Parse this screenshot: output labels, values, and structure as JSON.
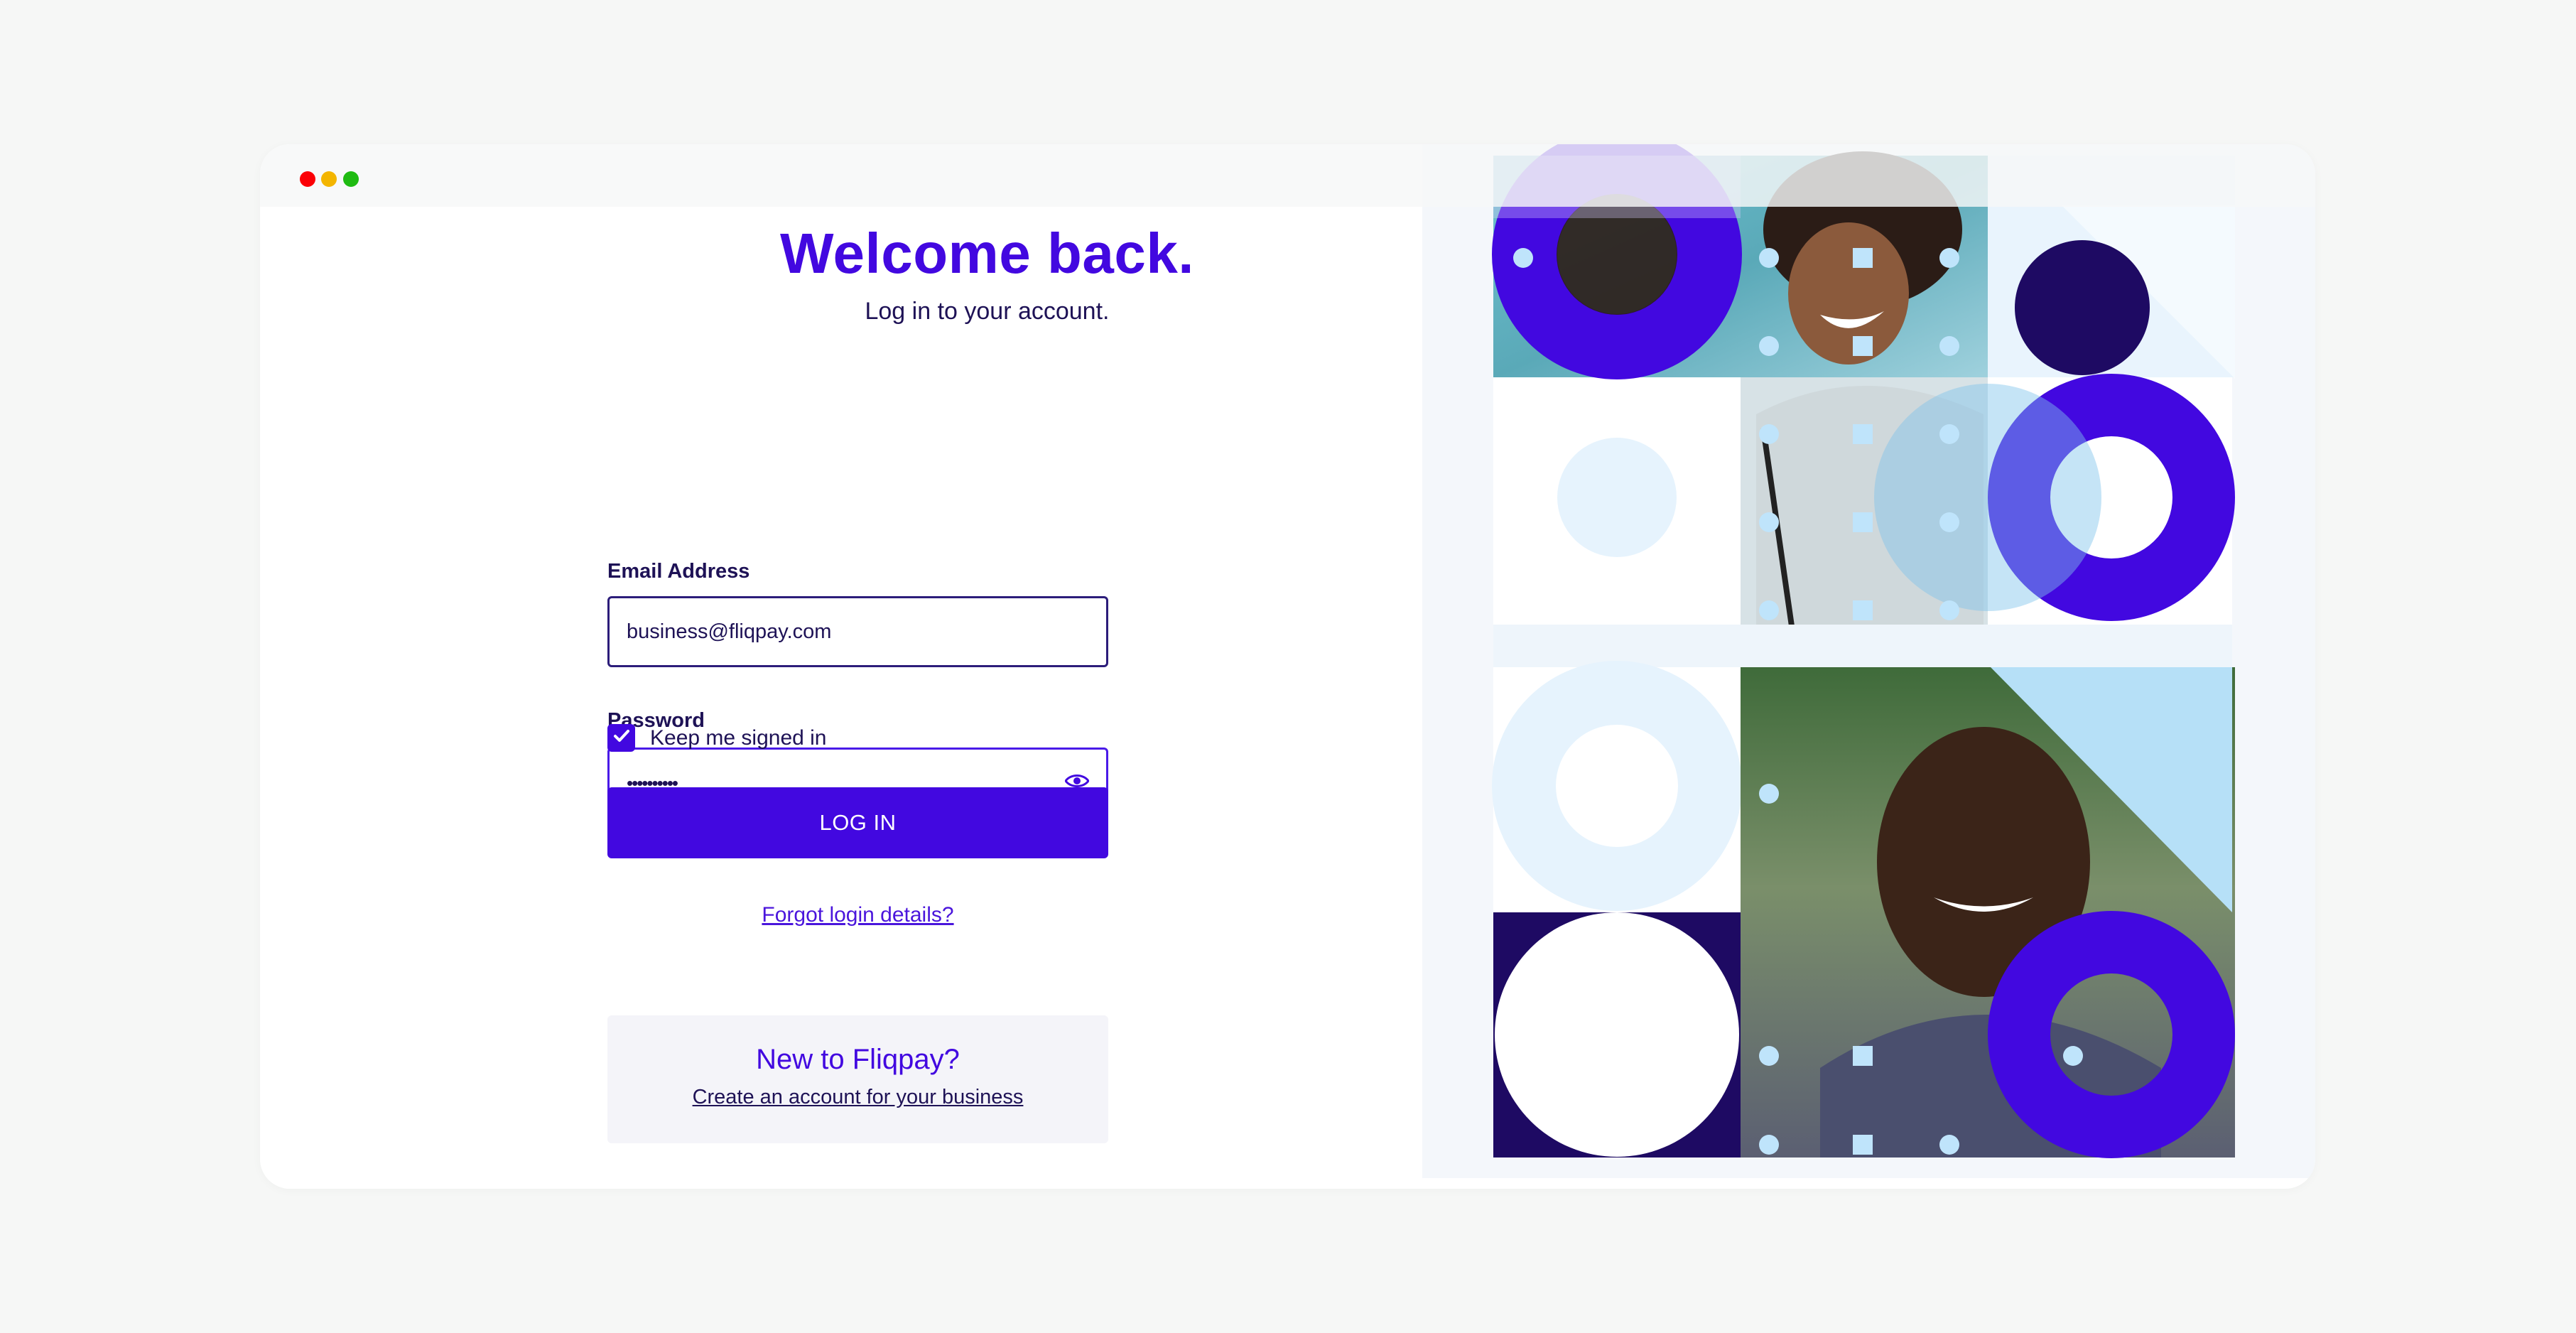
{
  "window": {
    "traffic_lights": [
      "close",
      "minimize",
      "zoom"
    ]
  },
  "login": {
    "title": "Welcome back.",
    "subtitle": "Log in to your account.",
    "email_label": "Email Address",
    "email_value": "business@fliqpay.com",
    "password_label": "Password",
    "password_value": "••••••••••",
    "keep_signed_in_label": "Keep me signed in",
    "keep_signed_in_checked": true,
    "login_button": "LOG IN",
    "forgot_link": "Forgot login details?"
  },
  "signup": {
    "question": "New to Fliqpay?",
    "link": "Create an account  for your business"
  },
  "colors": {
    "brand": "#4208e0",
    "navy": "#1e0a63",
    "light_blue": "#e6f3fd",
    "sky": "#b6e0f7",
    "text": "#1e1256"
  },
  "icons": [
    "eye-icon",
    "checkmark-icon"
  ]
}
